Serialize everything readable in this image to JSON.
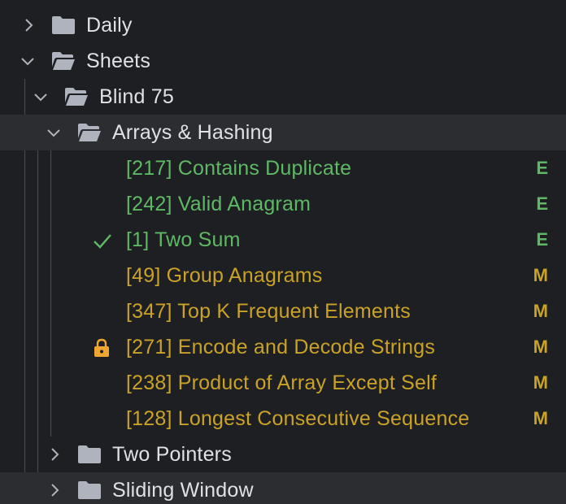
{
  "tree": {
    "daily": {
      "label": "Daily"
    },
    "sheets": {
      "label": "Sheets"
    },
    "blind75": {
      "label": "Blind 75"
    },
    "arrays_hashing": {
      "label": "Arrays & Hashing"
    },
    "problems": [
      {
        "label": "[217] Contains Duplicate",
        "difficulty": "E",
        "level": "easy",
        "status": ""
      },
      {
        "label": "[242] Valid Anagram",
        "difficulty": "E",
        "level": "easy",
        "status": ""
      },
      {
        "label": "[1] Two Sum",
        "difficulty": "E",
        "level": "easy",
        "status": "check-icon"
      },
      {
        "label": "[49] Group Anagrams",
        "difficulty": "M",
        "level": "medium",
        "status": ""
      },
      {
        "label": "[347] Top K Frequent Elements",
        "difficulty": "M",
        "level": "medium",
        "status": ""
      },
      {
        "label": "[271] Encode and Decode Strings",
        "difficulty": "M",
        "level": "medium",
        "status": "lock-icon"
      },
      {
        "label": "[238] Product of Array Except Self",
        "difficulty": "M",
        "level": "medium",
        "status": ""
      },
      {
        "label": "[128] Longest Consecutive Sequence",
        "difficulty": "M",
        "level": "medium",
        "status": ""
      }
    ],
    "two_pointers": {
      "label": "Two Pointers"
    },
    "sliding_window": {
      "label": "Sliding Window"
    }
  },
  "colors": {
    "background": "#1e1f22",
    "selected_row": "#2b2d30",
    "easy": "#5fb865",
    "medium": "#c9a227",
    "folder": "#aeb3bd",
    "lock": "#f0a732"
  }
}
